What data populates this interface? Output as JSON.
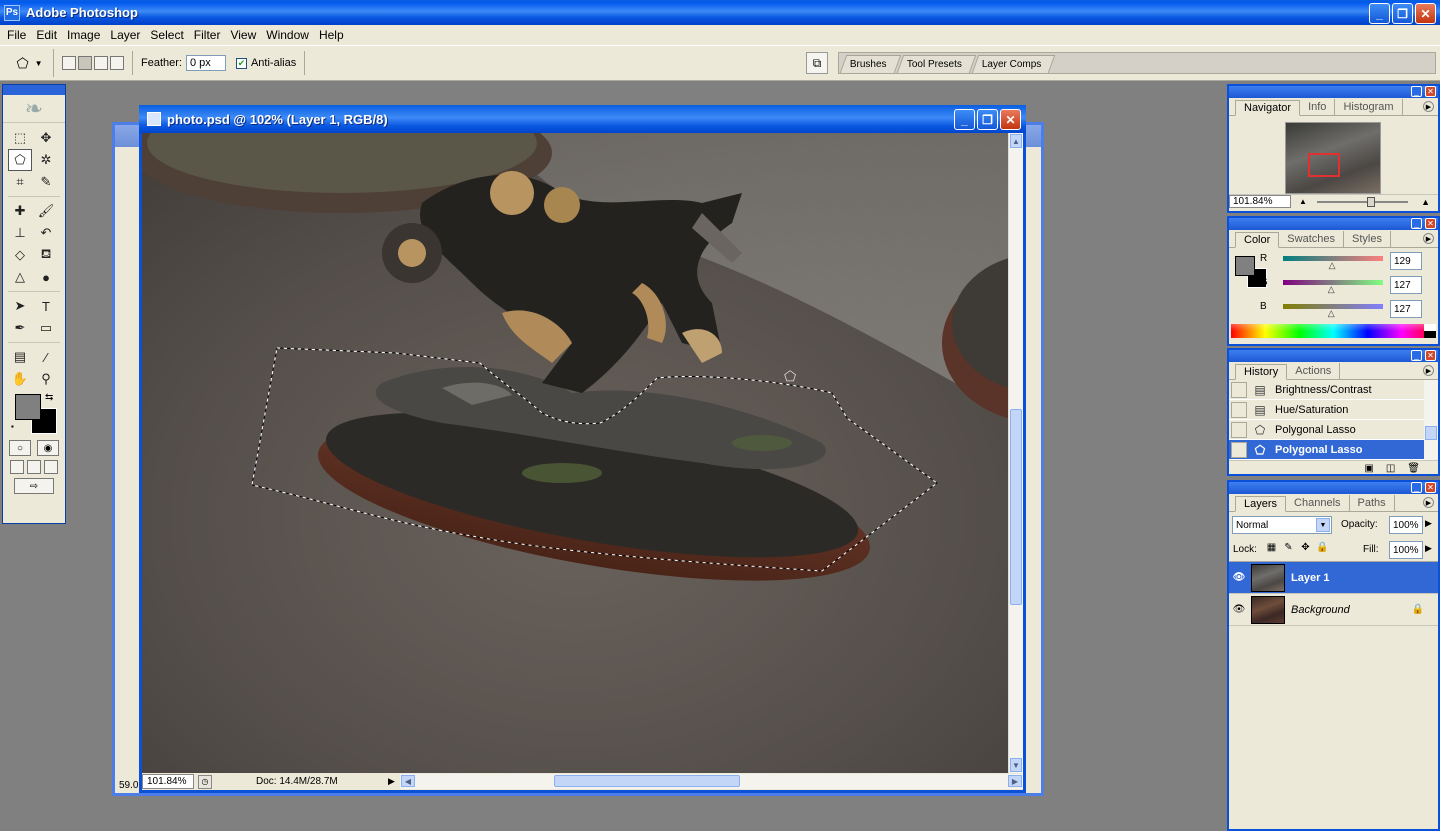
{
  "app": {
    "title": "Adobe Photoshop",
    "app_icon": "photoshop-icon",
    "window_controls": {
      "minimize": "_",
      "maximize": "❐",
      "close": "✕"
    }
  },
  "menu": [
    "File",
    "Edit",
    "Image",
    "Layer",
    "Select",
    "Filter",
    "View",
    "Window",
    "Help"
  ],
  "options_bar": {
    "tool_icon": "polygonal-lasso-icon",
    "feather_label": "Feather:",
    "feather_value": "0 px",
    "anti_alias_label": "Anti-alias",
    "anti_alias_checked": true,
    "palette_well_tabs": [
      "Brushes",
      "Tool Presets",
      "Layer Comps"
    ]
  },
  "toolbox": {
    "tools": [
      "rectangular-marquee-icon",
      "move-icon",
      "polygonal-lasso-icon",
      "magic-wand-icon",
      "crop-icon",
      "slice-icon",
      "healing-brush-icon",
      "brush-icon",
      "clone-stamp-icon",
      "history-brush-icon",
      "eraser-icon",
      "paint-bucket-icon",
      "blur-icon",
      "dodge-icon",
      "path-selection-icon",
      "type-icon",
      "pen-icon",
      "rectangle-shape-icon",
      "notes-icon",
      "eyedropper-icon",
      "hand-icon",
      "zoom-icon"
    ],
    "foreground_color": "#818080",
    "background_color": "#000000"
  },
  "document": {
    "title": "photo.psd @ 102% (Layer 1, RGB/8)",
    "zoom": "101.84%",
    "doc_info": "Doc: 14.4M/28.7M",
    "behind_zoom": "59.0"
  },
  "navigator": {
    "tabs": [
      "Navigator",
      "Info",
      "Histogram"
    ],
    "zoom": "101.84%",
    "view_box_color": "#e03030"
  },
  "color_panel": {
    "tabs": [
      "Color",
      "Swatches",
      "Styles"
    ],
    "channels": [
      {
        "label": "R",
        "value": "129",
        "fraction": 0.506
      },
      {
        "label": "G",
        "value": "127",
        "fraction": 0.498
      },
      {
        "label": "B",
        "value": "127",
        "fraction": 0.498
      }
    ]
  },
  "history": {
    "tabs": [
      "History",
      "Actions"
    ],
    "items": [
      {
        "label": "Brightness/Contrast",
        "icon": "adjustment-icon",
        "selected": false
      },
      {
        "label": "Hue/Saturation",
        "icon": "adjustment-icon",
        "selected": false
      },
      {
        "label": "Polygonal Lasso",
        "icon": "polygonal-lasso-icon",
        "selected": false
      },
      {
        "label": "Polygonal Lasso",
        "icon": "polygonal-lasso-icon",
        "selected": true
      }
    ]
  },
  "layers": {
    "tabs": [
      "Layers",
      "Channels",
      "Paths"
    ],
    "blend_mode": "Normal",
    "opacity_label": "Opacity:",
    "opacity": "100%",
    "lock_label": "Lock:",
    "fill_label": "Fill:",
    "fill": "100%",
    "items": [
      {
        "name": "Layer 1",
        "visible": true,
        "selected": true,
        "locked": false
      },
      {
        "name": "Background",
        "visible": true,
        "selected": false,
        "locked": true
      }
    ]
  }
}
